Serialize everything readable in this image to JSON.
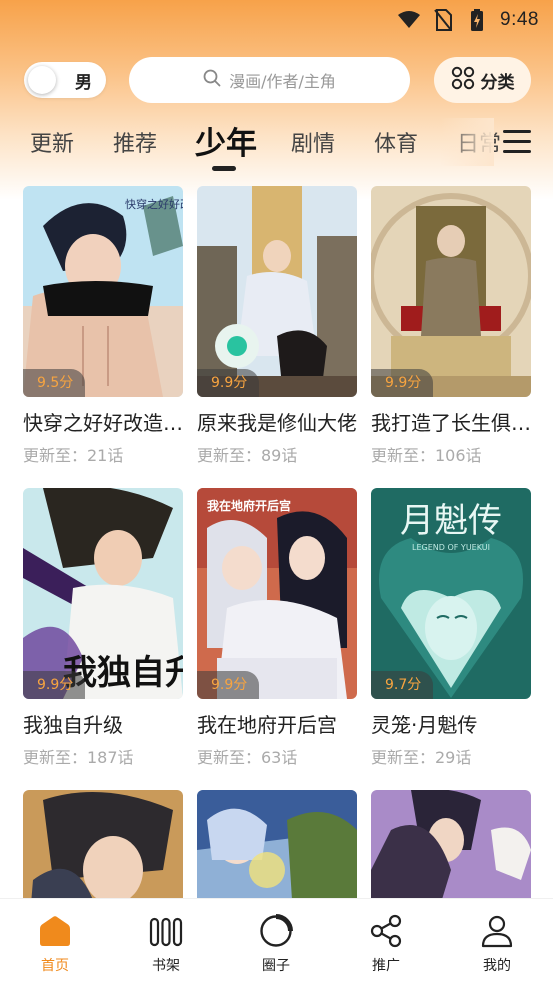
{
  "status_bar": {
    "time": "9:48"
  },
  "header": {
    "gender_label": "男",
    "search_placeholder": "漫画/作者/主角",
    "category_label": "分类"
  },
  "tabs": [
    {
      "label": "更新"
    },
    {
      "label": "推荐"
    },
    {
      "label": "少年",
      "active": true
    },
    {
      "label": "剧情"
    },
    {
      "label": "体育"
    },
    {
      "label": "日常"
    }
  ],
  "comics": [
    {
      "title": "快穿之好好改造男人",
      "update": "更新至：21话",
      "score": "9.5分",
      "has_score": true
    },
    {
      "title": "原来我是修仙大佬",
      "update": "更新至：89话",
      "score": "9.9分",
      "has_score": true
    },
    {
      "title": "我打造了长生俱乐部",
      "update": "更新至：106话",
      "score": "9.9分",
      "has_score": true
    },
    {
      "title": "我独自升级",
      "update": "更新至：187话",
      "score": "9.9分",
      "has_score": true
    },
    {
      "title": "我在地府开后宫",
      "update": "更新至：63话",
      "score": "9.9分",
      "has_score": true
    },
    {
      "title": "灵笼·月魁传",
      "update": "更新至：29话",
      "score": "9.7分",
      "has_score": true
    },
    {
      "title": "",
      "update": "",
      "score": ""
    },
    {
      "title": "",
      "update": "",
      "score": ""
    },
    {
      "title": "",
      "update": "",
      "score": ""
    }
  ],
  "cover_text": {
    "c0": "快穿之好好改造男人",
    "c3": "我独自升级",
    "c4": "我在地府开后宫",
    "c5_main": "月魁传",
    "c5_sub": "LEGEND OF YUEKUI"
  },
  "bottom_nav": [
    {
      "label": "首页",
      "icon": "home-icon",
      "active": true
    },
    {
      "label": "书架",
      "icon": "bookshelf-icon"
    },
    {
      "label": "圈子",
      "icon": "circle-icon"
    },
    {
      "label": "推广",
      "icon": "share-icon"
    },
    {
      "label": "我的",
      "icon": "profile-icon"
    }
  ],
  "colors": {
    "accent": "#f08a1c",
    "score": "#f7a440",
    "header_gradient_top": "#f7a24a"
  }
}
